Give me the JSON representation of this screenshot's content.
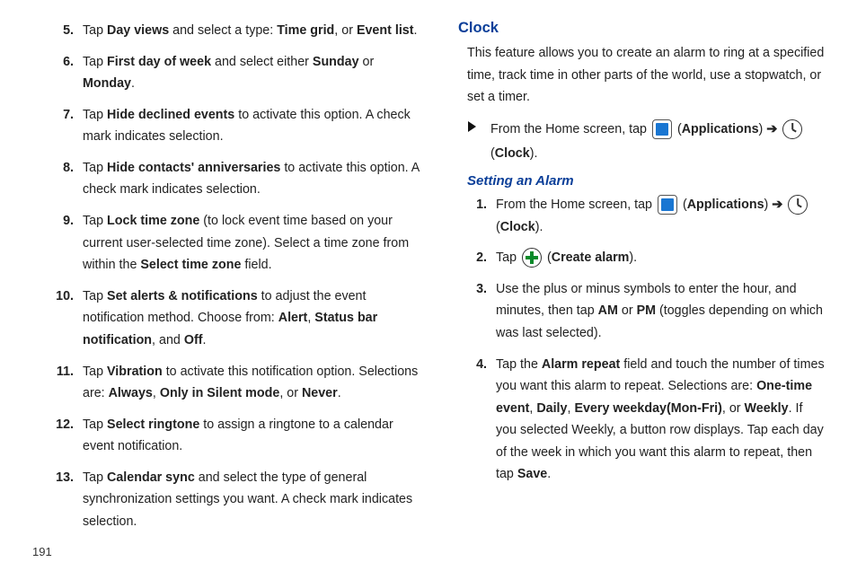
{
  "pageNumber": "191",
  "left": {
    "items": [
      {
        "num": "5.",
        "parts": [
          "Tap ",
          [
            "b",
            "Day views"
          ],
          " and select a type: ",
          [
            "b",
            "Time grid"
          ],
          ", or ",
          [
            "b",
            "Event list"
          ],
          "."
        ]
      },
      {
        "num": "6.",
        "parts": [
          "Tap ",
          [
            "b",
            "First day of week"
          ],
          " and select either ",
          [
            "b",
            "Sunday"
          ],
          " or ",
          [
            "b",
            "Monday"
          ],
          "."
        ]
      },
      {
        "num": "7.",
        "parts": [
          "Tap ",
          [
            "b",
            "Hide declined events"
          ],
          " to activate this option. A check mark indicates selection."
        ]
      },
      {
        "num": "8.",
        "parts": [
          "Tap ",
          [
            "b",
            "Hide contacts' anniversaries"
          ],
          " to activate this option. A check mark indicates selection."
        ]
      },
      {
        "num": "9.",
        "parts": [
          "Tap ",
          [
            "b",
            "Lock time zone"
          ],
          " (to lock event time based on your current user-selected time zone). Select a time zone from within the ",
          [
            "b",
            "Select time zone"
          ],
          " field."
        ]
      },
      {
        "num": "10.",
        "parts": [
          "Tap ",
          [
            "b",
            "Set alerts & notifications"
          ],
          " to adjust the event notification method. Choose from: ",
          [
            "b",
            "Alert"
          ],
          ", ",
          [
            "b",
            "Status bar notification"
          ],
          ", and ",
          [
            "b",
            "Off"
          ],
          "."
        ]
      },
      {
        "num": "11.",
        "parts": [
          "Tap ",
          [
            "b",
            "Vibration"
          ],
          " to activate this notification option. Selections are: ",
          [
            "b",
            "Always"
          ],
          ", ",
          [
            "b",
            "Only in Silent mode"
          ],
          ", or ",
          [
            "b",
            "Never"
          ],
          "."
        ]
      },
      {
        "num": "12.",
        "parts": [
          "Tap ",
          [
            "b",
            "Select ringtone"
          ],
          " to assign a ringtone to a calendar event notification."
        ]
      },
      {
        "num": "13.",
        "parts": [
          "Tap ",
          [
            "b",
            "Calendar sync"
          ],
          " and select the type of general synchronization settings you want. A check mark indicates selection."
        ]
      }
    ]
  },
  "right": {
    "heading": "Clock",
    "intro": "This feature allows you to create an alarm to ring at a specified time, track time in other parts of the world, use a stopwatch, or set a timer.",
    "bullet": {
      "parts": [
        "From the Home screen, tap ",
        [
          "icon",
          "apps"
        ],
        " (",
        [
          "b",
          "Applications"
        ],
        ") ",
        [
          "arrow",
          "➔"
        ],
        " ",
        [
          "icon",
          "clock"
        ],
        " (",
        [
          "b",
          "Clock"
        ],
        ")."
      ]
    },
    "subheading": "Setting an Alarm",
    "steps": [
      {
        "num": "1.",
        "parts": [
          "From the Home screen, tap ",
          [
            "icon",
            "apps"
          ],
          " (",
          [
            "b",
            "Applications"
          ],
          ") ",
          [
            "arrow",
            "➔"
          ],
          " ",
          [
            "icon",
            "clock"
          ],
          " (",
          [
            "b",
            "Clock"
          ],
          ")."
        ]
      },
      {
        "num": "2.",
        "parts": [
          "Tap ",
          [
            "icon",
            "plus"
          ],
          " (",
          [
            "b",
            "Create alarm"
          ],
          ")."
        ]
      },
      {
        "num": "3.",
        "parts": [
          "Use the plus or minus symbols to enter the hour, and minutes, then tap ",
          [
            "b",
            "AM"
          ],
          " or ",
          [
            "b",
            "PM"
          ],
          " (toggles depending on which was last selected)."
        ]
      },
      {
        "num": "4.",
        "parts": [
          "Tap the ",
          [
            "b",
            "Alarm repeat"
          ],
          " field and touch the number of times you want this alarm to repeat. Selections are: ",
          [
            "b",
            "One-time event"
          ],
          ", ",
          [
            "b",
            "Daily"
          ],
          ", ",
          [
            "b",
            "Every weekday(Mon-Fri)"
          ],
          ", or ",
          [
            "b",
            "Weekly"
          ],
          ". If you selected Weekly, a button row displays. Tap each day of the week in which you want this alarm to repeat, then tap ",
          [
            "b",
            "Save"
          ],
          "."
        ]
      }
    ]
  }
}
